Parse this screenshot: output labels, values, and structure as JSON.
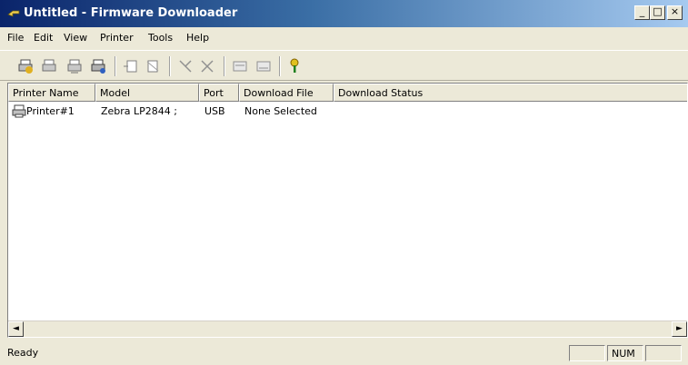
{
  "window": {
    "title": "Untitled - Firmware Downloader"
  },
  "title_buttons": {
    "minimize": "_",
    "maximize": "□",
    "close": "×"
  },
  "menu": [
    "File",
    "Edit",
    "View",
    "Printer",
    "Tools",
    "Help"
  ],
  "toolbar": {
    "buttons": [
      "printer-add-icon",
      "printer-remove-icon",
      "printer-properties-icon",
      "printer-test-icon",
      "list-add-icon",
      "list-remove-icon",
      "download-icon",
      "cancel-icon",
      "file-select-icon",
      "file-clear-icon",
      "help-key-icon"
    ]
  },
  "table": {
    "columns": [
      "Printer Name",
      "Model",
      "Port",
      "Download File",
      "Download Status"
    ],
    "rows": [
      {
        "name": "Printer#1",
        "model": "Zebra  LP2844 ;",
        "port": "USB",
        "file": "None Selected",
        "status": ""
      }
    ]
  },
  "scroll": {
    "left": "◄",
    "right": "►"
  },
  "status": {
    "text": "Ready",
    "num": "NUM"
  }
}
